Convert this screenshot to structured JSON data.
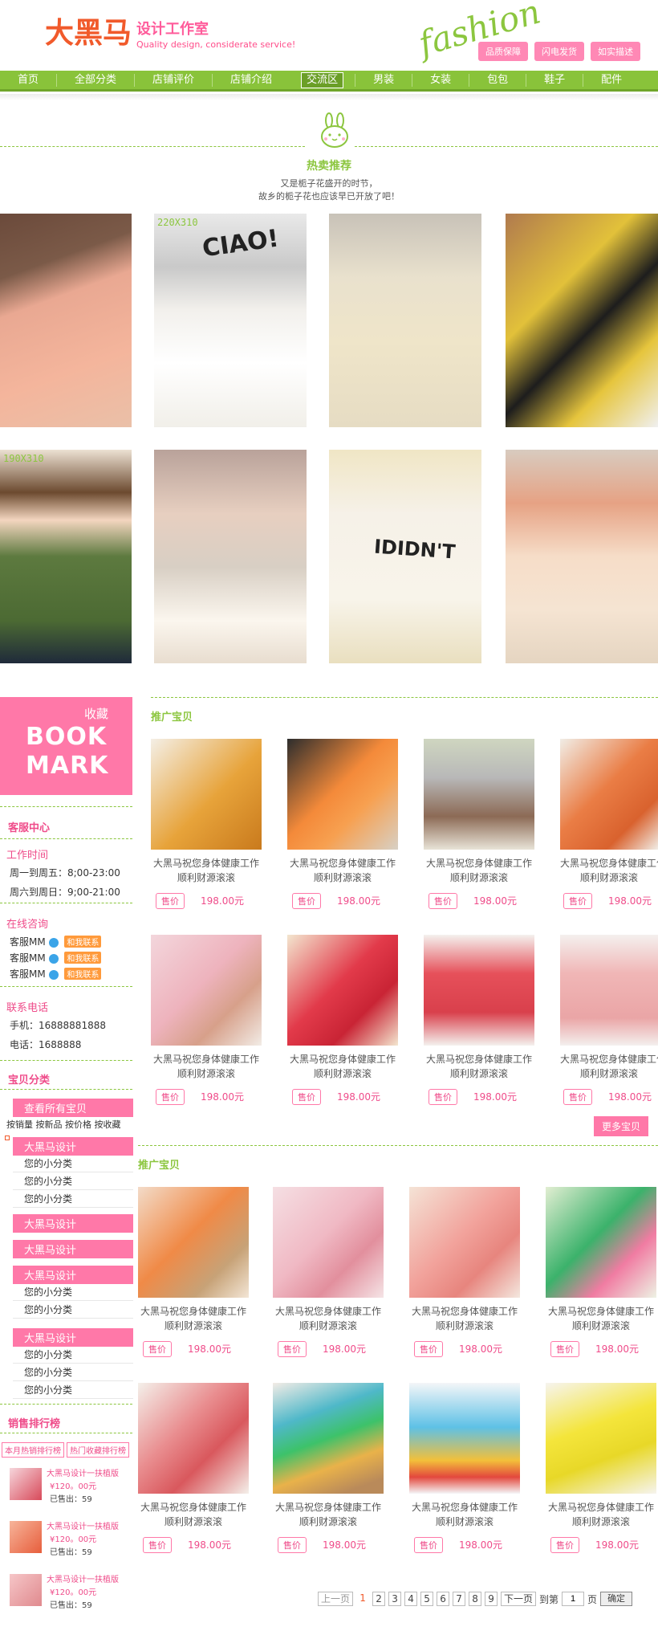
{
  "header": {
    "logo_main": "大黑马",
    "logo_sub_a": "设计工作室",
    "logo_sub_b": "Quality design, considerate service!",
    "fashion_script": "fashion",
    "badges": [
      "品质保障",
      "闪电发货",
      "如实描述"
    ]
  },
  "nav": {
    "items": [
      "首页",
      "全部分类",
      "店铺评价",
      "店铺介绍",
      "交流区",
      "男装",
      "女装",
      "包包",
      "鞋子",
      "配件"
    ],
    "active_index": 4
  },
  "hot": {
    "title": "热卖推荐",
    "sub1": "又是栀子花盛开的时节，",
    "sub2": "故乡的栀子花也应该早已开放了吧！",
    "size_label_1": "220X310",
    "size_label_2": "190X310"
  },
  "sidebar": {
    "bookmark_small": "收藏",
    "bookmark_big_1": "BOOK",
    "bookmark_big_2": "MARK",
    "service_title": "客服中心",
    "work_title": "工作时间",
    "work_1": "周一到周五：8;00-23:00",
    "work_2": "周六到周日：9;00-21:00",
    "online_title": "在线咨询",
    "cs_label": "客服MM",
    "cs_btn": "和我联系",
    "phone_title": "联系电话",
    "mobile": "手机：16888881888",
    "tel": "电话：1688888",
    "category_title": "宝贝分类",
    "all_items": "查看所有宝贝",
    "sort": "按销量 按新品 按价格 按收藏",
    "cat_name": "大黑马设计",
    "sub_cat": "您的小分类",
    "rank_title": "销售排行榜",
    "rank_tab_1": "本月热销排行榜",
    "rank_tab_2": "热门收藏排行榜",
    "rank_item_title": "大黑马设计一扶植版",
    "rank_item_price": "¥120。00元",
    "rank_item_sold": "已售出：59"
  },
  "products": {
    "section_title_1": "推广宝贝",
    "section_title_2": "推广宝贝",
    "desc_1": "大黑马祝您身体健康工作",
    "desc_2": "顺利财源滚滚",
    "price_label": "售价",
    "price": "198.00元",
    "more": "更多宝贝"
  },
  "pager": {
    "prev": "上一页",
    "pages": [
      "1",
      "2",
      "3",
      "4",
      "5",
      "6",
      "7",
      "8",
      "9"
    ],
    "current": "1",
    "next": "下一页",
    "goto": "到第",
    "page_value": "1",
    "page_unit": "页",
    "ok": "确定"
  },
  "colors": {
    "green": "#8cc63f",
    "pink": "#ff78a8",
    "orange": "#f15a2b"
  }
}
